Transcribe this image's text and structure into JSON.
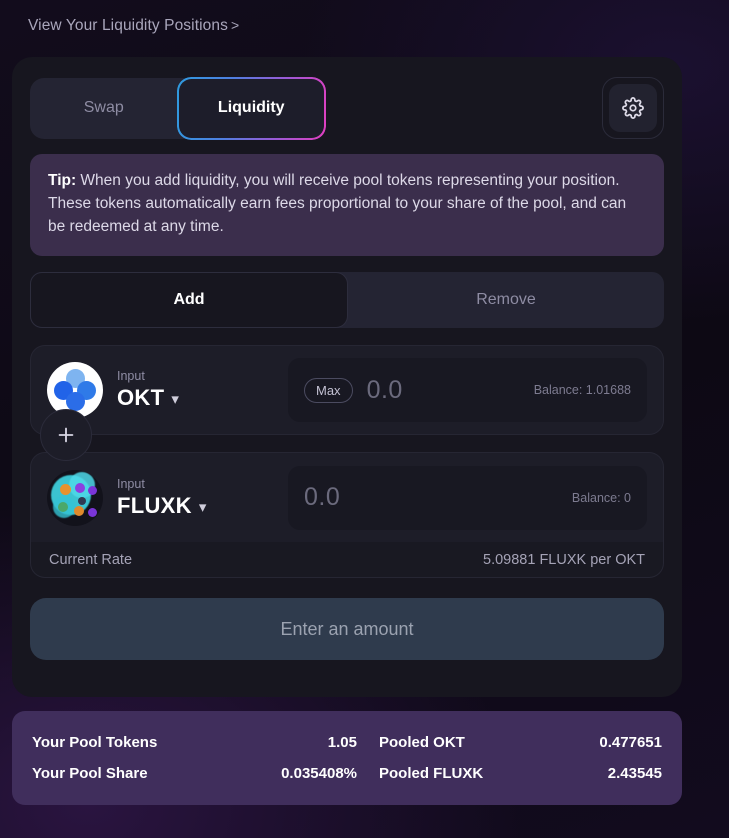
{
  "header": {
    "positions_link": "View Your Liquidity Positions",
    "positions_chevron": ">"
  },
  "tabs": {
    "swap_label": "Swap",
    "liquidity_label": "Liquidity",
    "settings_icon": "gear-icon",
    "active": "Liquidity",
    "gradient_from": "#2e9bdf",
    "gradient_to": "#e23ec0"
  },
  "tip": {
    "prefix": "Tip:",
    "text": " When you add liquidity, you will receive pool tokens representing your position. These tokens automatically earn fees proportional to your share of the pool, and can be redeemed at any time.",
    "background": "#3b2e4c"
  },
  "mode_tabs": {
    "add_label": "Add",
    "remove_label": "Remove",
    "active": "Add"
  },
  "inputs": [
    {
      "field_label": "Input",
      "symbol": "OKT",
      "caret_icon": "chevron-down-icon",
      "logo_icon": "okt-token-logo",
      "max_label": "Max",
      "amount": "0.0",
      "balance": "Balance: 1.01688"
    },
    {
      "field_label": "Input",
      "symbol": "FLUXK",
      "caret_icon": "chevron-down-icon",
      "logo_icon": "fluxk-token-logo",
      "amount": "0.0",
      "balance": "Balance: 0"
    }
  ],
  "plus_icon": "plus-icon",
  "rate": {
    "label": "Current Rate",
    "value": "5.09881 FLUXK per OKT"
  },
  "cta": {
    "label": "Enter an amount"
  },
  "pool": {
    "background": "#402e5c",
    "rows": [
      {
        "left_label": "Your Pool Tokens",
        "left_value": "1.05",
        "right_label": "Pooled OKT",
        "right_value": "0.477651"
      },
      {
        "left_label": "Your Pool Share",
        "left_value": "0.035408%",
        "right_label": "Pooled FLUXK",
        "right_value": "2.43545"
      }
    ]
  }
}
